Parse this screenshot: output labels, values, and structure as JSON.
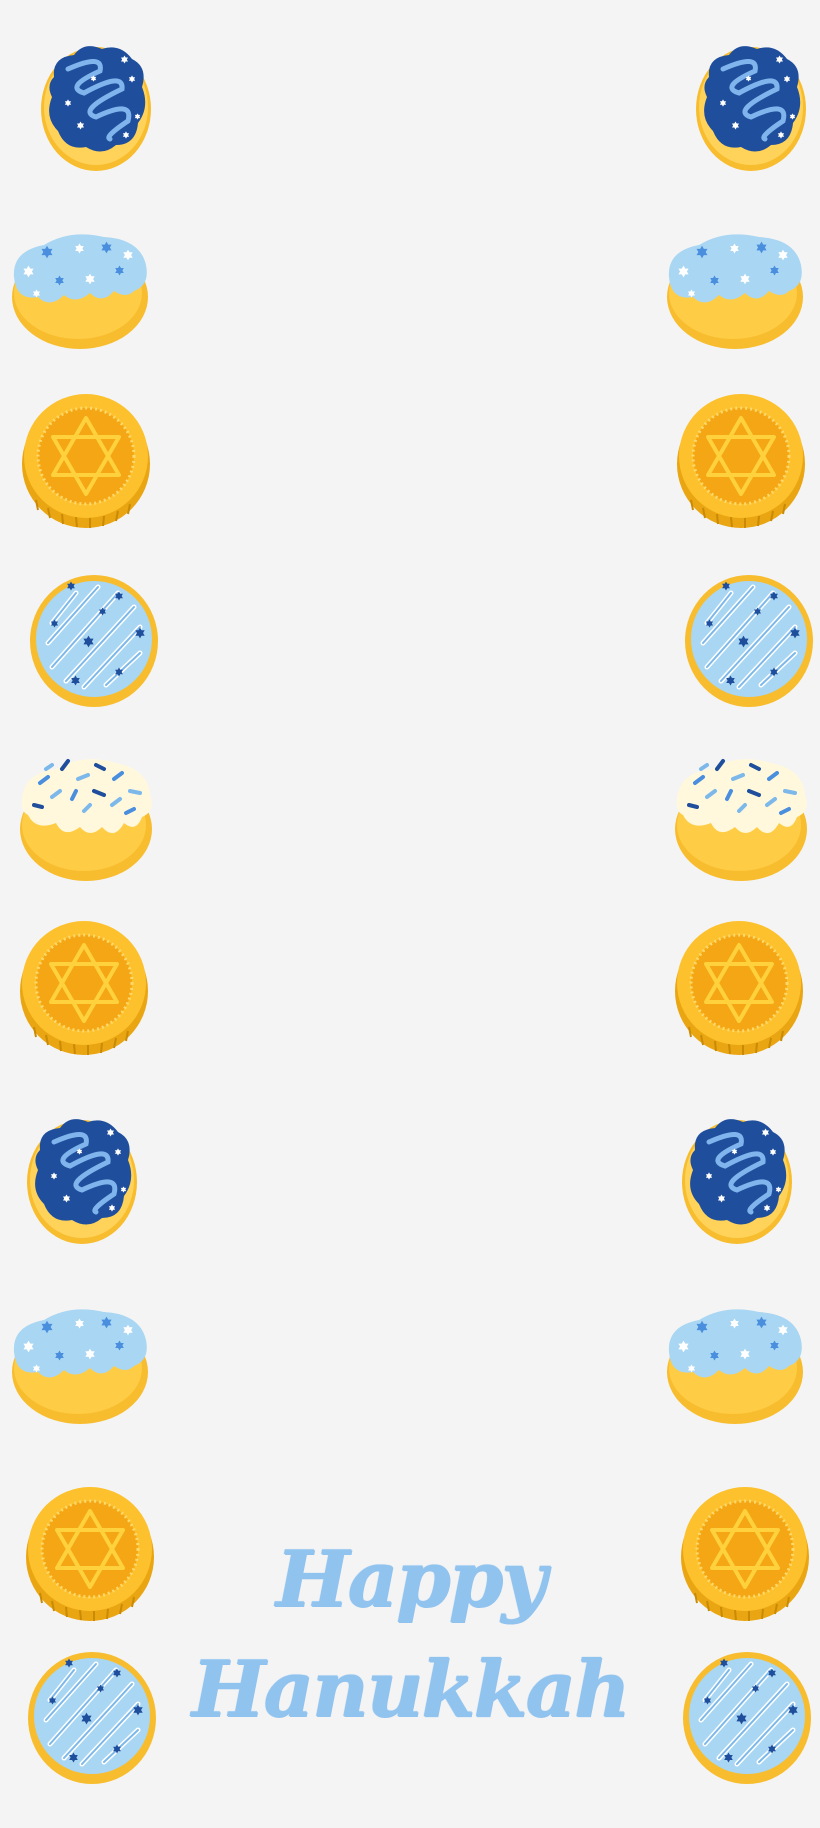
{
  "greeting": {
    "title": "Happy Hanukkah"
  },
  "border_items": {
    "left": [
      "glazed-donut-navy",
      "sufganiyah-light-blue",
      "gelt-coin",
      "glazed-donut-light-blue",
      "sufganiyah-white-sprinkles",
      "gelt-coin",
      "glazed-donut-navy",
      "sufganiyah-light-blue",
      "gelt-coin",
      "glazed-donut-light-blue"
    ],
    "right": [
      "glazed-donut-navy",
      "sufganiyah-light-blue",
      "gelt-coin",
      "glazed-donut-light-blue",
      "sufganiyah-white-sprinkles",
      "gelt-coin",
      "glazed-donut-navy",
      "sufganiyah-light-blue",
      "gelt-coin",
      "glazed-donut-light-blue"
    ]
  },
  "colors": {
    "background": "#f4f4f4",
    "title": "#91c3ef",
    "navy_glaze": "#1f4e9c",
    "light_blue_glaze": "#a9d6f2",
    "gold": "#f7bd2f",
    "gold_dark": "#e9a512"
  }
}
